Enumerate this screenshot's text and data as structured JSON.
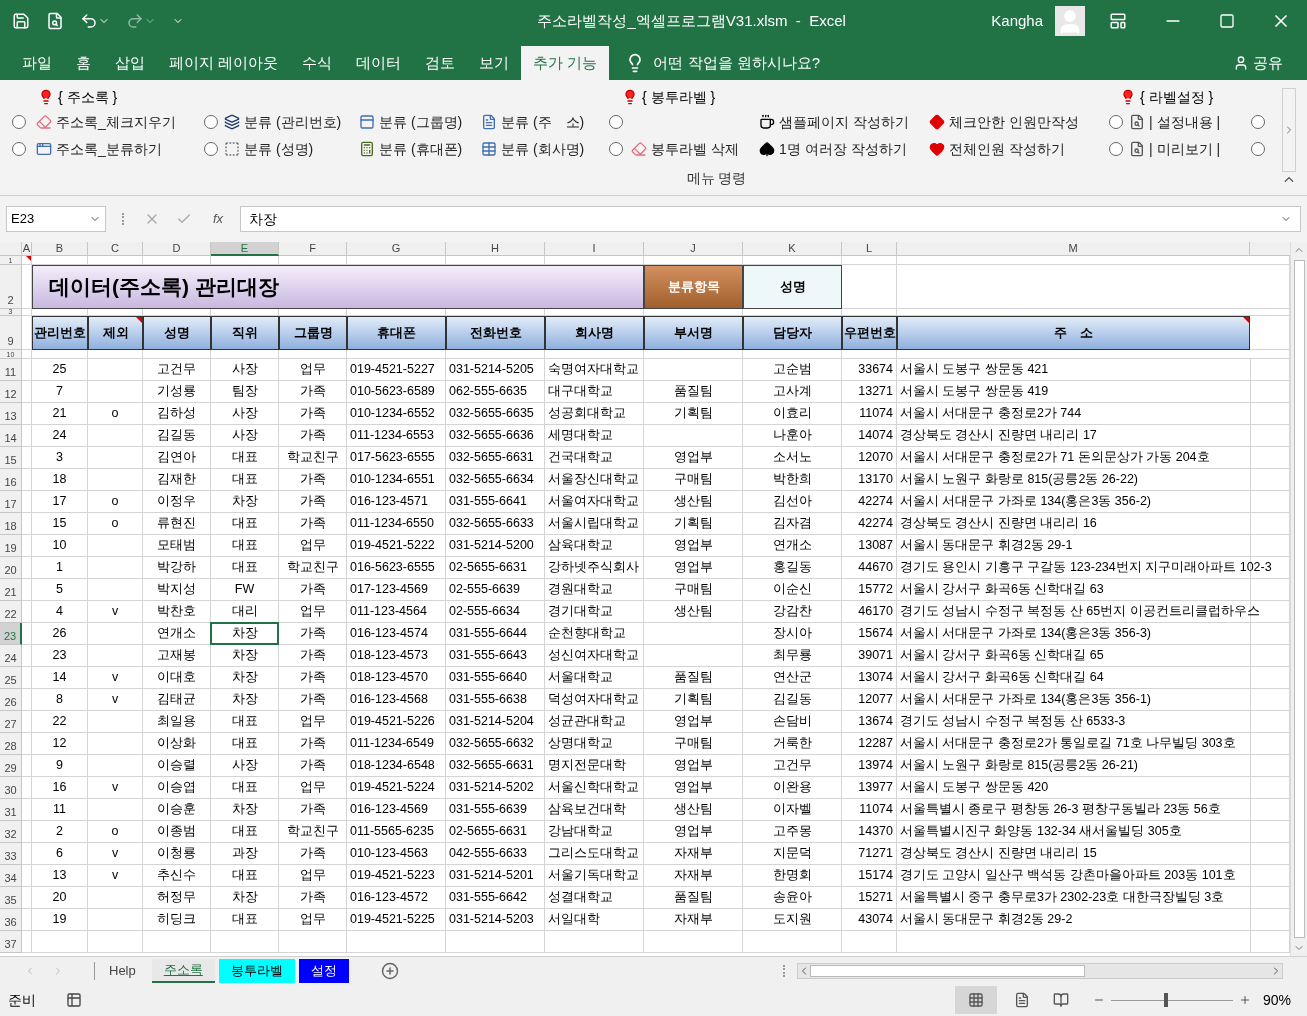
{
  "title_bar": {
    "title": "주소라벨작성_엑셀프로그램V31.xlsm  -  Excel",
    "user": "Kangha"
  },
  "ribbon_tabs": [
    {
      "label": "파일",
      "selected": false
    },
    {
      "label": "홈",
      "selected": false
    },
    {
      "label": "삽입",
      "selected": false
    },
    {
      "label": "페이지 레이아웃",
      "selected": false
    },
    {
      "label": "수식",
      "selected": false
    },
    {
      "label": "데이터",
      "selected": false
    },
    {
      "label": "검토",
      "selected": false
    },
    {
      "label": "보기",
      "selected": false
    },
    {
      "label": "추가 기능",
      "selected": true
    }
  ],
  "tell_me": "어떤 작업을 원하시나요?",
  "share": "공유",
  "ribbon": {
    "headings": [
      "{ 주소록 }",
      "{ 봉투라벨 }",
      "{ 라벨설정 }"
    ],
    "rows": [
      [
        {
          "kind": "radio",
          "selected": false
        },
        {
          "kind": "command",
          "label": "주소록_체크지우기"
        },
        {
          "kind": "radio",
          "selected": false
        },
        {
          "kind": "command",
          "label": "분류 (관리번호)"
        },
        {
          "kind": "command",
          "label": "분류 (그룹명)"
        },
        {
          "kind": "command",
          "label": "분류 (주　소)"
        },
        {
          "kind": "radio",
          "selected": false
        },
        {
          "kind": "blank"
        },
        {
          "kind": "command",
          "label": "샘플페이지 작성하기"
        },
        {
          "kind": "command",
          "label": "체크안한 인원만작성"
        },
        {
          "kind": "radio",
          "selected": false
        },
        {
          "kind": "command",
          "label": "| 설정내용 |"
        },
        {
          "kind": "radio",
          "selected": false
        }
      ],
      [
        {
          "kind": "radio",
          "selected": false
        },
        {
          "kind": "command",
          "label": "주소록_분류하기"
        },
        {
          "kind": "radio",
          "selected": false
        },
        {
          "kind": "command",
          "label": "분류 (성명)"
        },
        {
          "kind": "command",
          "label": "분류 (휴대폰)"
        },
        {
          "kind": "command",
          "label": "분류 (회사명)"
        },
        {
          "kind": "radio",
          "selected": false
        },
        {
          "kind": "command",
          "label": "봉투라벨 삭제"
        },
        {
          "kind": "command",
          "label": "1명 여러장 작성하기"
        },
        {
          "kind": "command",
          "label": "전체인원 작성하기"
        },
        {
          "kind": "radio",
          "selected": false
        },
        {
          "kind": "command",
          "label": "| 미리보기 |"
        },
        {
          "kind": "radio",
          "selected": false
        }
      ]
    ],
    "group_label": "메뉴 명령"
  },
  "formula_bar": {
    "name_box": "E23",
    "function_label": "fx",
    "value": "차장"
  },
  "column_letters": [
    {
      "label": "A",
      "selected": false
    },
    {
      "label": "B",
      "selected": false
    },
    {
      "label": "C",
      "selected": false
    },
    {
      "label": "D",
      "selected": false
    },
    {
      "label": "E",
      "selected": true
    },
    {
      "label": "F",
      "selected": false
    },
    {
      "label": "G",
      "selected": false
    },
    {
      "label": "H",
      "selected": false
    },
    {
      "label": "I",
      "selected": false
    },
    {
      "label": "J",
      "selected": false
    },
    {
      "label": "K",
      "selected": false
    },
    {
      "label": "L",
      "selected": false
    },
    {
      "label": "M",
      "selected": false
    }
  ],
  "row_numbers": [
    {
      "label": "1",
      "selected": false
    },
    {
      "label": "2",
      "selected": false
    },
    {
      "label": "3",
      "selected": false
    },
    {
      "label": "9",
      "selected": false
    },
    {
      "label": "10",
      "selected": false
    },
    {
      "label": "11",
      "selected": false
    },
    {
      "label": "12",
      "selected": false
    },
    {
      "label": "13",
      "selected": false
    },
    {
      "label": "14",
      "selected": false
    },
    {
      "label": "15",
      "selected": false
    },
    {
      "label": "16",
      "selected": false
    },
    {
      "label": "17",
      "selected": false
    },
    {
      "label": "18",
      "selected": false
    },
    {
      "label": "19",
      "selected": false
    },
    {
      "label": "20",
      "selected": false
    },
    {
      "label": "21",
      "selected": false
    },
    {
      "label": "22",
      "selected": false
    },
    {
      "label": "23",
      "selected": true
    },
    {
      "label": "24",
      "selected": false
    },
    {
      "label": "25",
      "selected": false
    },
    {
      "label": "26",
      "selected": false
    },
    {
      "label": "27",
      "selected": false
    },
    {
      "label": "28",
      "selected": false
    },
    {
      "label": "29",
      "selected": false
    },
    {
      "label": "30",
      "selected": false
    },
    {
      "label": "31",
      "selected": false
    },
    {
      "label": "32",
      "selected": false
    },
    {
      "label": "33",
      "selected": false
    },
    {
      "label": "34",
      "selected": false
    },
    {
      "label": "35",
      "selected": false
    },
    {
      "label": "36",
      "selected": false
    },
    {
      "label": "37",
      "selected": false
    }
  ],
  "sheet": {
    "title": "데이터(주소록) 관리대장",
    "category_label": "분류항목",
    "category_value": "성명",
    "columns": [
      "관리번호",
      "제외",
      "성명",
      "직위",
      "그룹명",
      "휴대폰",
      "전화번호",
      "회사명",
      "부서명",
      "담당자",
      "우편번호",
      "주　소"
    ],
    "rows": [
      [
        "25",
        null,
        "고건무",
        "사장",
        "업무",
        "019-4521-5227",
        "031-5214-5205",
        "숙명여자대학교",
        null,
        "고순범",
        "33674",
        "서울시 도봉구 쌍문동 421"
      ],
      [
        "7",
        null,
        "기성룡",
        "팀장",
        "가족",
        "010-5623-6589",
        "062-555-6635",
        "대구대학교",
        "품질팀",
        "고사계",
        "13271",
        "서울시 도봉구 쌍문동 419"
      ],
      [
        "21",
        "o",
        "김하성",
        "사장",
        "가족",
        "010-1234-6552",
        "032-5655-6635",
        "성공회대학교",
        "기획팀",
        "이효리",
        "11074",
        "서울시 서대문구 충정로2가 744"
      ],
      [
        "24",
        null,
        "김길동",
        "사장",
        "가족",
        "011-1234-6553",
        "032-5655-6636",
        "세명대학교",
        null,
        "나훈아",
        "14074",
        "경상북도 경산시 진량면 내리리 17"
      ],
      [
        "3",
        null,
        "김연아",
        "대표",
        "학교친구",
        "017-5623-6555",
        "032-5655-6631",
        "건국대학교",
        "영업부",
        "소서노",
        "12070",
        "서울시 서대문구 충정로2가 71 돈의문상가 가동 204호"
      ],
      [
        "18",
        null,
        "김재한",
        "대표",
        "가족",
        "010-1234-6551",
        "032-5655-6634",
        "서울장신대학교",
        "구매팀",
        "박한희",
        "13170",
        "서울시 노원구 화랑로 815(공릉2동 26-22)"
      ],
      [
        "17",
        "o",
        "이정우",
        "차장",
        "가족",
        "016-123-4571",
        "031-555-6641",
        "서울여자대학교",
        "생산팀",
        "김선아",
        "42274",
        "서울시 서대문구 가좌로 134(홍은3동 356-2)"
      ],
      [
        "15",
        "o",
        "류현진",
        "대표",
        "가족",
        "011-1234-6550",
        "032-5655-6633",
        "서울시립대학교",
        "기획팀",
        "김자겸",
        "42274",
        "경상북도 경산시 진량면 내리리 16"
      ],
      [
        "10",
        null,
        "모태범",
        "대표",
        "업무",
        "019-4521-5222",
        "031-5214-5200",
        "삼육대학교",
        "영업부",
        "연개소",
        "13087",
        "서울시 동대문구 휘경2동 29-1"
      ],
      [
        "1",
        null,
        "박강하",
        "대표",
        "학교친구",
        "016-5623-6555",
        "02-5655-6631",
        "강하넷주식회사",
        "영업부",
        "홍길동",
        "44670",
        "경기도 용인시 기흥구 구갈동 123-234번지 지구미래아파트 102-3"
      ],
      [
        "5",
        null,
        "박지성",
        "FW",
        "가족",
        "017-123-4569",
        "02-555-6639",
        "경원대학교",
        "구매팀",
        "이순신",
        "15772",
        "서울시 강서구 화곡6동 신학대길 63"
      ],
      [
        "4",
        "v",
        "박찬호",
        "대리",
        "업무",
        "011-123-4564",
        "02-555-6634",
        "경기대학교",
        "생산팀",
        "강감찬",
        "46170",
        "경기도 성남시 수정구 복정동 산 65번지 이공컨트리클럽하우스"
      ],
      [
        "26",
        null,
        "연개소",
        "차장",
        "가족",
        "016-123-4574",
        "031-555-6644",
        "순천향대학교",
        null,
        "장시아",
        "15674",
        "서울시 서대문구 가좌로 134(홍은3동 356-3)"
      ],
      [
        "23",
        null,
        "고재봉",
        "차장",
        "가족",
        "018-123-4573",
        "031-555-6643",
        "성신여자대학교",
        null,
        "최무룡",
        "39071",
        "서울시 강서구 화곡6동 신학대길 65"
      ],
      [
        "14",
        "v",
        "이대호",
        "차장",
        "가족",
        "018-123-4570",
        "031-555-6640",
        "서울대학교",
        "품질팀",
        "연산군",
        "13074",
        "서울시 강서구 화곡6동 신학대길 64"
      ],
      [
        "8",
        "v",
        "김태균",
        "차장",
        "가족",
        "016-123-4568",
        "031-555-6638",
        "덕성여자대학교",
        "기획팀",
        "김길동",
        "12077",
        "서울시 서대문구 가좌로 134(홍은3동 356-1)"
      ],
      [
        "22",
        null,
        "최일용",
        "대표",
        "업무",
        "019-4521-5226",
        "031-5214-5204",
        "성균관대학교",
        "영업부",
        "손담비",
        "13674",
        "경기도 성남시 수정구 복정동 산 6533-3"
      ],
      [
        "12",
        null,
        "이상화",
        "대표",
        "가족",
        "011-1234-6549",
        "032-5655-6632",
        "상명대학교",
        "구매팀",
        "거룩한",
        "12287",
        "서울시 서대문구 충정로2가 통일로길 71호 나무빌딩 303호"
      ],
      [
        "9",
        null,
        "이승렬",
        "사장",
        "가족",
        "018-1234-6548",
        "032-5655-6631",
        "명지전문대학",
        "영업부",
        "고건무",
        "13974",
        "서울시 노원구 화랑로 815(공릉2동 26-21)"
      ],
      [
        "16",
        "v",
        "이승엽",
        "대표",
        "업무",
        "019-4521-5224",
        "031-5214-5202",
        "서울신학대학교",
        "영업부",
        "이완용",
        "13977",
        "서울시 도봉구 쌍문동 420"
      ],
      [
        "11",
        null,
        "이승훈",
        "차장",
        "가족",
        "016-123-4569",
        "031-555-6639",
        "삼육보건대학",
        "생산팀",
        "이자벨",
        "11074",
        "서울특별시 종로구 평창동 26-3 평창구동빌라 23동 56호"
      ],
      [
        "2",
        "o",
        "이종범",
        "대표",
        "학교친구",
        "011-5565-6235",
        "02-5655-6631",
        "강남대학교",
        "영업부",
        "고주몽",
        "14370",
        "서울특별시진구 화양동 132-34 새서울빌딩 305호"
      ],
      [
        "6",
        "v",
        "이청룡",
        "과장",
        "가족",
        "010-123-4563",
        "042-555-6633",
        "그리스도대학교",
        "자재부",
        "지문덕",
        "71271",
        "경상북도 경산시 진량면 내리리 15"
      ],
      [
        "13",
        "v",
        "추신수",
        "대표",
        "업무",
        "019-4521-5223",
        "031-5214-5201",
        "서울기독대학교",
        "자재부",
        "한명회",
        "15174",
        "경기도 고양시 일산구 백석동 강촌마을아파트 203동 101호"
      ],
      [
        "20",
        null,
        "허정무",
        "차장",
        "가족",
        "016-123-4572",
        "031-555-6642",
        "성결대학교",
        "품질팀",
        "송윤아",
        "15271",
        "서울특별시 중구 충무로3가 2302-23호 대한극장빌딩 3호"
      ],
      [
        "19",
        null,
        "히딩크",
        "대표",
        "업무",
        "019-4521-5225",
        "031-5214-5203",
        "서일대학",
        "자재부",
        "도지원",
        "43074",
        "서울시 동대문구 휘경2동 29-2"
      ]
    ]
  },
  "sheet_tabs": [
    {
      "label": "Help",
      "selected": false
    },
    {
      "label": "주소록",
      "selected": true
    },
    {
      "label": "봉투라벨",
      "selected": false,
      "color": "#00ffff"
    },
    {
      "label": "설정",
      "selected": false,
      "color": "#0000ff"
    }
  ],
  "status_bar": {
    "status": "준비",
    "zoom": "90%",
    "zoom_slider": {
      "level": 0.45
    }
  }
}
